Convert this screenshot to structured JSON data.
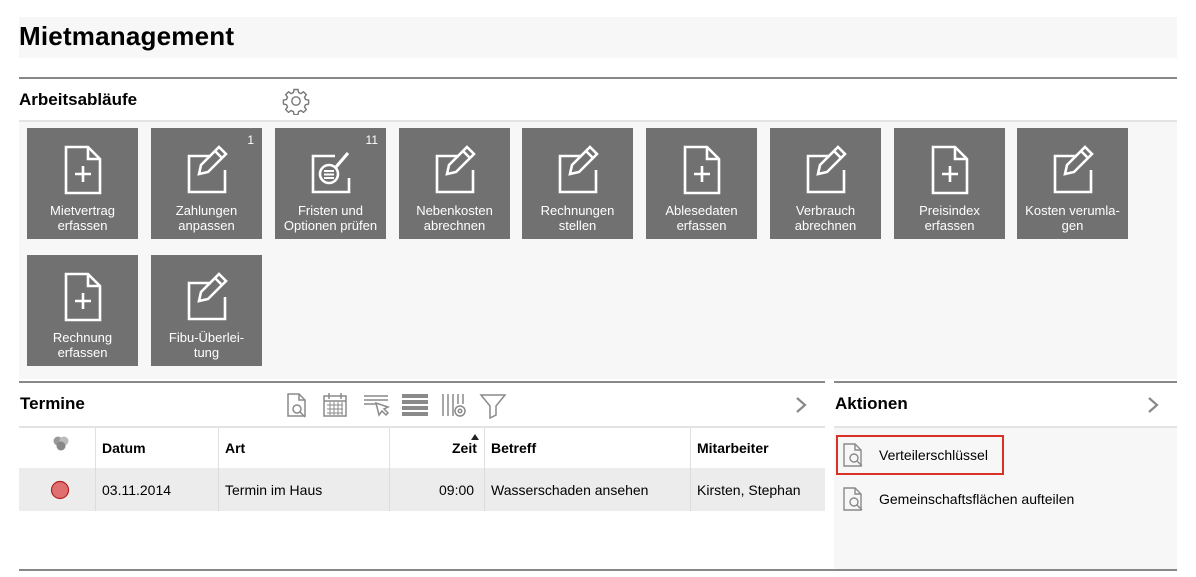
{
  "page": {
    "title": "Mietmanagement"
  },
  "workflows": {
    "heading": "Arbeitsabläufe",
    "tiles": [
      {
        "label_l1": "Mietvertrag",
        "label_l2": "erfassen",
        "icon": "file-plus-icon",
        "badge": ""
      },
      {
        "label_l1": "Zahlungen",
        "label_l2": "anpassen",
        "icon": "edit-icon",
        "badge": "1"
      },
      {
        "label_l1": "Fristen und",
        "label_l2": "Optionen prüfen",
        "icon": "list-search-icon",
        "badge": "11"
      },
      {
        "label_l1": "Nebenkosten",
        "label_l2": "abrechnen",
        "icon": "edit-icon",
        "badge": ""
      },
      {
        "label_l1": "Rechnungen",
        "label_l2": "stellen",
        "icon": "edit-icon",
        "badge": ""
      },
      {
        "label_l1": "Ablesedaten",
        "label_l2": "erfassen",
        "icon": "file-plus-icon",
        "badge": ""
      },
      {
        "label_l1": "Verbrauch",
        "label_l2": "abrechnen",
        "icon": "edit-icon",
        "badge": ""
      },
      {
        "label_l1": "Preisindex",
        "label_l2": "erfassen",
        "icon": "file-plus-icon",
        "badge": ""
      },
      {
        "label_l1": "Kosten verumla-",
        "label_l2": "gen",
        "icon": "edit-icon",
        "badge": ""
      },
      {
        "label_l1": "Rechnung",
        "label_l2": "erfassen",
        "icon": "file-plus-icon",
        "badge": ""
      },
      {
        "label_l1": "Fibu-Überlei-",
        "label_l2": "tung",
        "icon": "edit-icon",
        "badge": ""
      }
    ]
  },
  "termine": {
    "heading": "Termine",
    "columns": [
      "Datum",
      "Art",
      "Zeit",
      "Betreff",
      "Mitarbeiter"
    ],
    "rows": [
      {
        "status_color": "#e07070",
        "datum": "03.11.2014",
        "art": "Termin im Haus",
        "zeit": "09:00",
        "betreff": "Wasserschaden ansehen",
        "mitarbeiter": "Kirsten, Stephan"
      }
    ]
  },
  "aktionen": {
    "heading": "Aktionen",
    "items": [
      {
        "label": "Verteilerschlüssel",
        "selected": true
      },
      {
        "label": "Gemeinschaftsflächen aufteilen",
        "selected": false
      }
    ]
  },
  "colors": {
    "tile_bg": "#717171",
    "selection_border": "#d9302a",
    "section_rule": "#888888"
  }
}
